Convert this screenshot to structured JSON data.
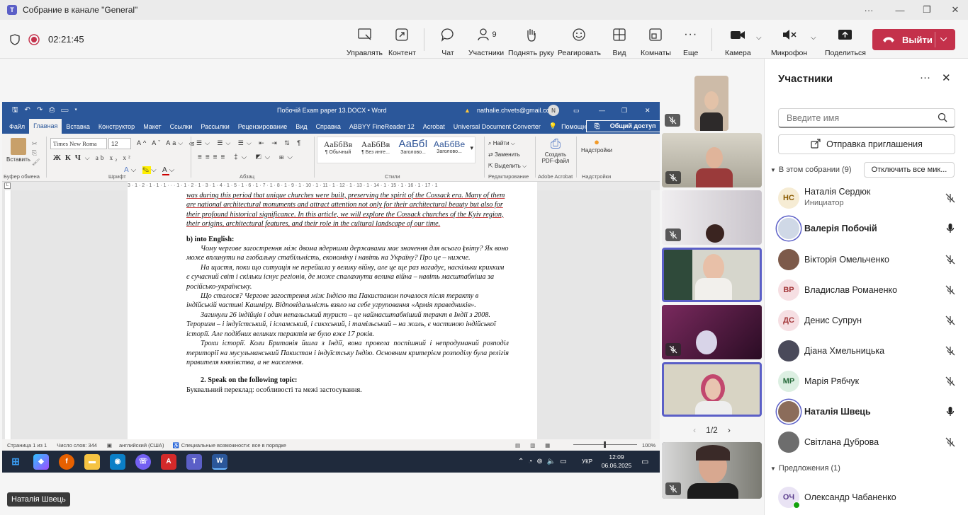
{
  "window": {
    "title": "Собрание в канале \"General\""
  },
  "meeting": {
    "timer": "02:21:45",
    "toolbar": {
      "manage": "Управлять",
      "content": "Контент",
      "chat": "Чат",
      "participants": "Участники",
      "participants_count": "9",
      "raise_hand": "Поднять руку",
      "react": "Реагировать",
      "view": "Вид",
      "rooms": "Комнаты",
      "more": "Еще",
      "camera": "Камера",
      "mic": "Микрофон",
      "share": "Поделиться",
      "leave": "Выйти"
    }
  },
  "word": {
    "title": "Побочій Exam paper 13.DOCX  •  Word",
    "account": "nathalie.chvets@gmail.com",
    "account_initial": "N",
    "tabs": [
      "Файл",
      "Главная",
      "Вставка",
      "Конструктор",
      "Макет",
      "Ссылки",
      "Рассылки",
      "Рецензирование",
      "Вид",
      "Справка",
      "ABBYY FineReader 12",
      "Acrobat",
      "Universal Document Converter"
    ],
    "help": "Помощн",
    "share": "Общий доступ",
    "ribbon": {
      "paste": "Вставить",
      "font": "Times New Roma",
      "size": "12",
      "styles": [
        {
          "sample": "АаБбВв",
          "name": "¶ Обычный"
        },
        {
          "sample": "АаБбВв",
          "name": "¶ Без инте..."
        },
        {
          "sample": "АаБбI",
          "name": "Заголово..."
        },
        {
          "sample": "АаБбВе",
          "name": "Заголово..."
        }
      ],
      "find": "Найти",
      "replace": "Заменить",
      "select": "Выделить",
      "pdf": "Создать PDF-файл",
      "addins": "Надстройки",
      "groups": [
        "Буфер обмена",
        "Шрифт",
        "Абзац",
        "Стили",
        "Редактирование",
        "Adobe Acrobat",
        "Надстройки"
      ]
    },
    "ruler": "3 · 1 · 2 · 1 · 1 · 1 · · · 1 · 1 · 2 · 1 · 3 · 1 · 4 · 1 · 5 · 1 · 6 · 1 · 7 · 1 · 8 · 1 · 9 · 1 · 10 · 1 · 11 · 1 · 12 · 1 · 13 · 1 · 14 · 1 · 15 · 1 · 16 · 1 · 17 · 1",
    "doc": {
      "en_para": "was during this period that unique churches were built, preserving the spirit of the Cossack era. Many of them are national architectural monuments and attract attention not only for their architectural beauty but also for their profound historical significance. In this article, we will explore the Cossack churches of the Kyiv region, their origins, architectural features, and their role in the cultural landscape of our time.",
      "heading_b": "b) into English:",
      "p1": "Чому чергове загострення між двома ядерними державами має значення для всього світу? Як воно може вплинути на глобальну стабільність, економіку і навіть на Україну? Про це – нижче.",
      "p2": "На щастя, поки що ситуація не перейшла у велику війну, але це ще раз нагадує, наскільки крихким є сучасний світ і скільки існує регіонів, де може спалахнути велика війна – навіть масштабніша за російсько-українську.",
      "p3": "Що сталося? Чергове загострення між Індією та Пакистаном почалося після теракту в індійській частині Кашміру. Відповідальність взяло на себе угруповання «Армія праведників».",
      "p4": "Загинули 26 індійців і один непальський турист – це наймасштабніший теракт в Індії з 2008. Тероризм – і індуїстський, і ісламський, і сикхський, і тамільський – на жаль, є частиною індійської історії. Але подібних великих терактів не було вже 17 років.",
      "p5": "Трохи історії. Коли Британія йшла з Індії, вона провела поспішний і непродуманий розподіл території на мусульманський Пакистан і індуїстську Індію. Основним критерієм розподілу була релігія правителя князівства, а не населення.",
      "heading_2": "2. Speak on the following topic:",
      "topic": "Буквальний переклад: особливості та межі застосування."
    },
    "status": {
      "page": "Страница 1 из 1",
      "words": "Число слов: 344",
      "lang": "английский (США)",
      "access": "Специальные возможности: все в порядке",
      "zoom": "100%"
    },
    "taskbar": {
      "lang": "УКР",
      "time": "12:09",
      "date": "06.06.2025"
    }
  },
  "speaker_name": "Наталія Швець",
  "pager": "1/2",
  "panel": {
    "title": "Участники",
    "search_placeholder": "Введите имя",
    "invite": "Отправка приглашения",
    "in_meeting": "В этом собрании (9)",
    "mute_all": "Отключить все мик...",
    "suggestions": "Предложения (1)",
    "participants": [
      {
        "initials": "НС",
        "name": "Наталія Сердюк",
        "role": "Инициатор",
        "bg": "#f6ecd4",
        "fg": "#8a5a00",
        "mic": "off"
      },
      {
        "initials": "",
        "name": "Валерія Побочій",
        "role": "",
        "bg": "#cfd8e6",
        "fg": "#333",
        "mic": "on",
        "bold": true
      },
      {
        "initials": "",
        "name": "Вікторія Омельченко",
        "role": "",
        "bg": "#7d5a4a",
        "fg": "#fff",
        "mic": "off"
      },
      {
        "initials": "ВР",
        "name": "Владислав Романенко",
        "role": "",
        "bg": "#f6dfe3",
        "fg": "#a4373a",
        "mic": "off"
      },
      {
        "initials": "ДС",
        "name": "Денис Супрун",
        "role": "",
        "bg": "#f6dfe3",
        "fg": "#a4373a",
        "mic": "off"
      },
      {
        "initials": "",
        "name": "Діана Хмельницька",
        "role": "",
        "bg": "#4a4a5a",
        "fg": "#fff",
        "mic": "off"
      },
      {
        "initials": "МР",
        "name": "Марія Рябчук",
        "role": "",
        "bg": "#dcefe2",
        "fg": "#276b3b",
        "mic": "off"
      },
      {
        "initials": "",
        "name": "Наталія Швець",
        "role": "",
        "bg": "#8b6c5a",
        "fg": "#fff",
        "mic": "on",
        "bold": true
      },
      {
        "initials": "",
        "name": "Світлана Дуброва",
        "role": "",
        "bg": "#6d6d6d",
        "fg": "#fff",
        "mic": "off"
      }
    ],
    "suggested": [
      {
        "initials": "ОЧ",
        "name": "Олександр Чабаненко",
        "bg": "#e9e3f4",
        "fg": "#5a3d8c"
      }
    ]
  }
}
